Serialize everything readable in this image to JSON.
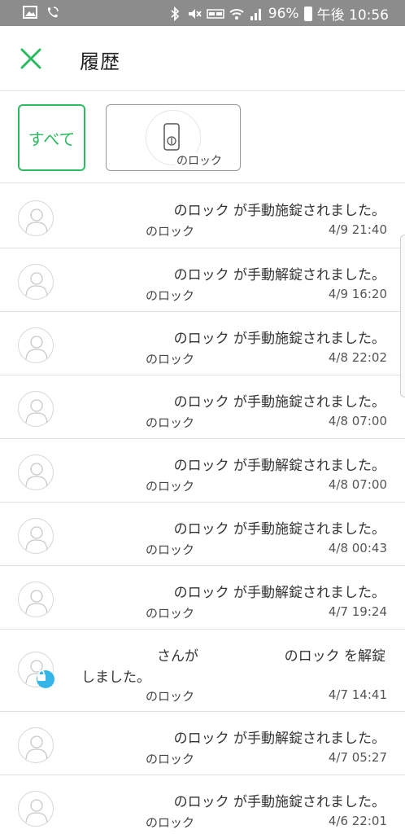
{
  "status_bar": {
    "battery": "96%",
    "time": "午後 10:56",
    "icons": [
      "image-icon",
      "wifi-calling-icon",
      "bluetooth-icon",
      "mute-icon",
      "volte-icon",
      "wifi-icon",
      "signal-icon",
      "battery-icon"
    ]
  },
  "header": {
    "title": "履歴",
    "close_icon": "close-icon"
  },
  "filters": {
    "all_label": "すべて",
    "lock_label": "のロック"
  },
  "history": [
    {
      "message": "のロック が手動施錠されました。",
      "lock": "のロック",
      "time": "4/9 21:40"
    },
    {
      "message": "のロック が手動解錠されました。",
      "lock": "のロック",
      "time": "4/9 16:20"
    },
    {
      "message": "のロック が手動施錠されました。",
      "lock": "のロック",
      "time": "4/8 22:02"
    },
    {
      "message": "のロック が手動施錠されました。",
      "lock": "のロック",
      "time": "4/8 07:00"
    },
    {
      "message": "のロック が手動解錠されました。",
      "lock": "のロック",
      "time": "4/8 07:00"
    },
    {
      "message": "のロック が手動施錠されました。",
      "lock": "のロック",
      "time": "4/8 00:43"
    },
    {
      "message": "のロック が手動解錠されました。",
      "lock": "のロック",
      "time": "4/7 19:24"
    },
    {
      "message_part1": "さんが",
      "message_part2": "のロック を解錠",
      "message_line2": "しました。",
      "lock": "のロック",
      "time": "4/7 14:41"
    },
    {
      "message": "のロック が手動解錠されました。",
      "lock": "のロック",
      "time": "4/7 05:27"
    },
    {
      "message": "のロック が手動施錠されました。",
      "lock": "のロック",
      "time": "4/6 22:01"
    }
  ],
  "colors": {
    "accent": "#2dbb62",
    "badge": "#35b4e8",
    "status_bar": "#8c8c8c"
  }
}
